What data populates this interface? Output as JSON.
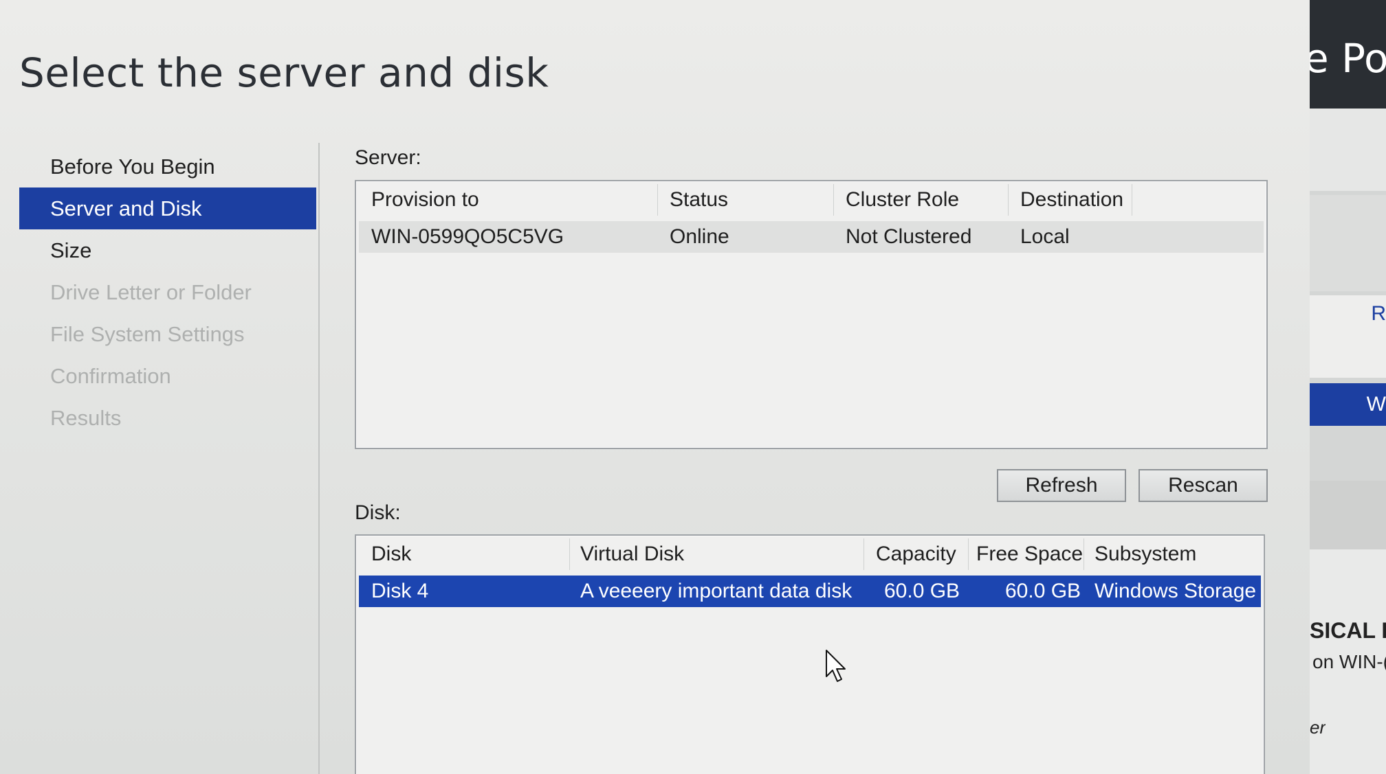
{
  "header": {
    "title": "Select the server and disk"
  },
  "nav": {
    "items": [
      {
        "label": "Before You Begin",
        "state": "normal"
      },
      {
        "label": "Server and Disk",
        "state": "active"
      },
      {
        "label": "Size",
        "state": "normal"
      },
      {
        "label": "Drive Letter or Folder",
        "state": "disabled"
      },
      {
        "label": "File System Settings",
        "state": "disabled"
      },
      {
        "label": "Confirmation",
        "state": "disabled"
      },
      {
        "label": "Results",
        "state": "disabled"
      }
    ]
  },
  "server": {
    "label": "Server:",
    "columns": [
      "Provision to",
      "Status",
      "Cluster Role",
      "Destination"
    ],
    "rows": [
      {
        "provision_to": "WIN-0599QO5C5VG",
        "status": "Online",
        "cluster_role": "Not Clustered",
        "destination": "Local"
      }
    ]
  },
  "buttons": {
    "refresh": "Refresh",
    "rescan": "Rescan"
  },
  "disk": {
    "label": "Disk:",
    "columns": [
      "Disk",
      "Virtual Disk",
      "Capacity",
      "Free Space",
      "Subsystem"
    ],
    "rows": [
      {
        "disk": "Disk 4",
        "virtual_disk": "A veeeery important data disk",
        "capacity": "60.0 GB",
        "free_space": "60.0 GB",
        "subsystem": "Windows Storage"
      }
    ]
  },
  "background_window": {
    "title_fragment": "e Poo",
    "link_fragment": "R",
    "selected_fragment": "W",
    "heading_fragment": "SICAL D",
    "subheading_fragment": "on WIN-(",
    "footer_fragment": "er"
  },
  "colors": {
    "accent": "#1c3fa1",
    "selection": "#1c45b0",
    "disabled_text": "#aeb0af"
  },
  "icons": {
    "cursor": "mouse-pointer-icon"
  }
}
